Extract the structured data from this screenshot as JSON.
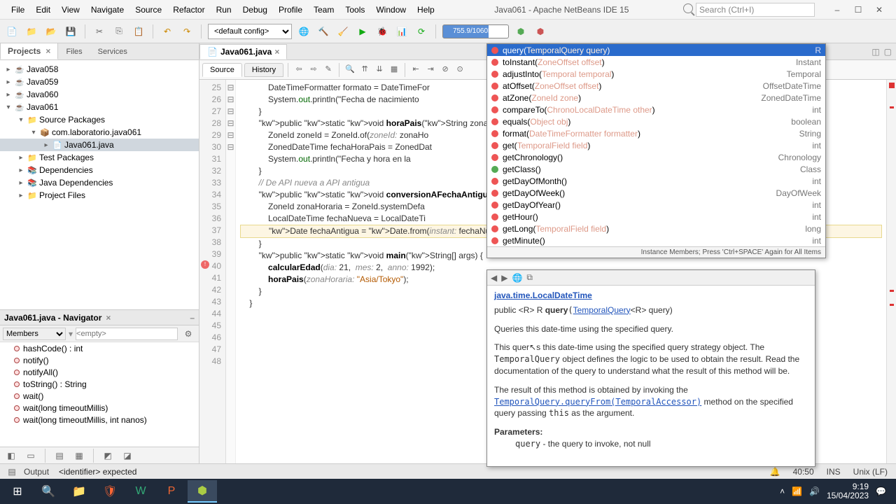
{
  "window": {
    "title": "Java061 - Apache NetBeans IDE 15",
    "search_placeholder": "Search (Ctrl+I)"
  },
  "menus": [
    "File",
    "Edit",
    "View",
    "Navigate",
    "Source",
    "Refactor",
    "Run",
    "Debug",
    "Profile",
    "Team",
    "Tools",
    "Window",
    "Help"
  ],
  "toolbar": {
    "config": "<default config>",
    "memory": "755.9/1060MB"
  },
  "projects": {
    "tabs": [
      "Projects",
      "Files",
      "Services"
    ],
    "items": [
      {
        "name": "Java058",
        "depth": 0,
        "exp": false,
        "icon": "☕"
      },
      {
        "name": "Java059",
        "depth": 0,
        "exp": false,
        "icon": "☕"
      },
      {
        "name": "Java060",
        "depth": 0,
        "exp": false,
        "icon": "☕"
      },
      {
        "name": "Java061",
        "depth": 0,
        "exp": true,
        "icon": "☕"
      },
      {
        "name": "Source Packages",
        "depth": 1,
        "exp": true,
        "icon": "📁"
      },
      {
        "name": "com.laboratorio.java061",
        "depth": 2,
        "exp": true,
        "icon": "📦"
      },
      {
        "name": "Java061.java",
        "depth": 3,
        "exp": false,
        "icon": "📄",
        "sel": true
      },
      {
        "name": "Test Packages",
        "depth": 1,
        "exp": false,
        "icon": "📁"
      },
      {
        "name": "Dependencies",
        "depth": 1,
        "exp": false,
        "icon": "📚"
      },
      {
        "name": "Java Dependencies",
        "depth": 1,
        "exp": false,
        "icon": "📚"
      },
      {
        "name": "Project Files",
        "depth": 1,
        "exp": false,
        "icon": "📁"
      }
    ]
  },
  "navigator": {
    "title": "Java061.java - Navigator",
    "filter1": "Members",
    "filter2_ph": "<empty>",
    "items": [
      "hashCode() : int",
      "notify()",
      "notifyAll()",
      "toString() : String",
      "wait()",
      "wait(long timeoutMillis)",
      "wait(long timeoutMillis, int nanos)"
    ]
  },
  "editor": {
    "tab": "Java061.java",
    "subtabs": [
      "Source",
      "History"
    ],
    "lines_start": 25,
    "code": [
      "            DateTimeFormatter formato = DateTimeFor",
      "            System.out.println(\"Fecha de nacimiento",
      "        }",
      "",
      "        public static void horaPais(String zonaHor",
      "            ZoneId zoneId = ZoneId.of(zoneId: zonaHo",
      "            ZonedDateTime fechaHoraPais = ZonedDat",
      "            System.out.println(\"Fecha y hora en la",
      "        }",
      "",
      "        // De API nueva a API antigua",
      "        public static void conversionAFechaAntigua",
      "            ZoneId zonaHoraria = ZoneId.systemDefa",
      "            LocalDateTime fechaNueva = LocalDateTi",
      "",
      "            Date fechaAntigua = Date.from(instant: fechaNueva.);",
      "        }",
      "",
      "        public static void main(String[] args) {",
      "            calcularEdad(dia: 21,  mes: 2,  anno: 1992);",
      "",
      "            horaPais(zonaHoraria: \"Asia/Tokyo\");",
      "        }",
      "    }"
    ],
    "current_line_index": 15
  },
  "autocomplete": {
    "footer": "Instance Members; Press 'Ctrl+SPACE' Again for All Items",
    "items": [
      {
        "sig": "query(TemporalQuery<R> query)",
        "ret": "R",
        "sel": true,
        "c": "r"
      },
      {
        "sig": "toInstant(ZoneOffset offset)",
        "ret": "Instant",
        "c": "r"
      },
      {
        "sig": "adjustInto(Temporal temporal)",
        "ret": "Temporal",
        "c": "r"
      },
      {
        "sig": "atOffset(ZoneOffset offset)",
        "ret": "OffsetDateTime",
        "c": "r"
      },
      {
        "sig": "atZone(ZoneId zone)",
        "ret": "ZonedDateTime",
        "c": "r"
      },
      {
        "sig": "compareTo(ChronoLocalDateTime<?> other)",
        "ret": "int",
        "c": "r"
      },
      {
        "sig": "equals(Object obj)",
        "ret": "boolean",
        "c": "r"
      },
      {
        "sig": "format(DateTimeFormatter formatter)",
        "ret": "String",
        "c": "r"
      },
      {
        "sig": "get(TemporalField field)",
        "ret": "int",
        "c": "r"
      },
      {
        "sig": "getChronology()",
        "ret": "Chronology",
        "c": "r"
      },
      {
        "sig": "getClass()",
        "ret": "Class<?>",
        "c": "g"
      },
      {
        "sig": "getDayOfMonth()",
        "ret": "int",
        "c": "r"
      },
      {
        "sig": "getDayOfWeek()",
        "ret": "DayOfWeek",
        "c": "r"
      },
      {
        "sig": "getDayOfYear()",
        "ret": "int",
        "c": "r"
      },
      {
        "sig": "getHour()",
        "ret": "int",
        "c": "r"
      },
      {
        "sig": "getLong(TemporalField field)",
        "ret": "long",
        "c": "r"
      },
      {
        "sig": "getMinute()",
        "ret": "int",
        "c": "r"
      }
    ]
  },
  "javadoc": {
    "class_link": "java.time.LocalDateTime",
    "sig_pre": "public <R> R ",
    "sig_name": "query",
    "sig_link": "TemporalQuery",
    "sig_post": "<R> query)",
    "p1": "Queries this date-time using the specified query.",
    "p2a": "This quer",
    "p2a2": "s this date-time using the specified query strategy object. The ",
    "p2b": "TemporalQuery",
    "p2c": " object defines the logic to be used to obtain the result. Read the documentation of the query to understand what the result of this method will be.",
    "p3a": "The result of this method is obtained by invoking the ",
    "p3link": "TemporalQuery.queryFrom(TemporalAccessor)",
    "p3b": " method on the specified query passing ",
    "p3c": "this",
    "p3d": " as the argument.",
    "params_h": "Parameters:",
    "param1": "query",
    "param1d": " - the query to invoke, not null"
  },
  "status": {
    "output": "Output",
    "msg": "<identifier> expected",
    "pos": "40:50",
    "ins": "INS",
    "enc": "Unix (LF)"
  },
  "tray": {
    "time": "9:19",
    "date": "15/04/2023"
  }
}
